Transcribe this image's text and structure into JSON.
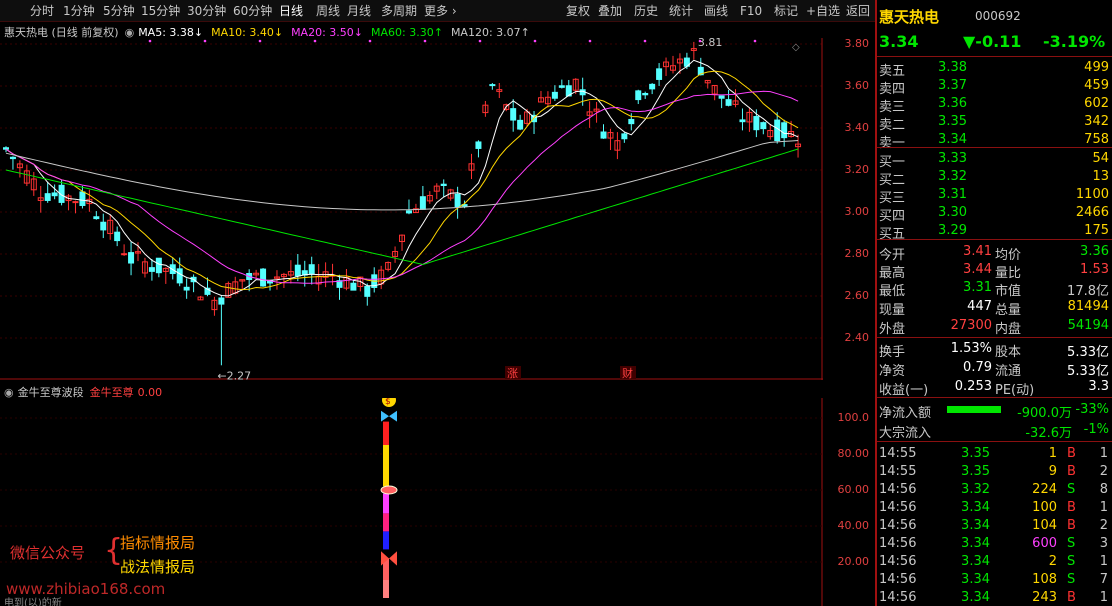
{
  "toolbar": {
    "tabs": [
      "分时",
      "1分钟",
      "5分钟",
      "15分钟",
      "30分钟",
      "60分钟",
      "日线",
      "周线",
      "月线",
      "多周期",
      "更多 ›"
    ],
    "right_items": [
      "复权",
      "叠加",
      "历史",
      "统计",
      "画线",
      "F10",
      "标记",
      "+自选",
      "返回"
    ],
    "active_tab": "日线"
  },
  "chart": {
    "title": "惠天热电 (日线 前复权)",
    "ma": [
      {
        "label": "MA5: 3.38↓",
        "color": "#ffffff"
      },
      {
        "label": "MA10: 3.40↓",
        "color": "#ffd700"
      },
      {
        "label": "MA20: 3.50↓",
        "color": "#ff40ff"
      },
      {
        "label": "MA60: 3.30↑",
        "color": "#00e600"
      },
      {
        "label": "MA120: 3.07↑",
        "color": "#c8c8c8"
      }
    ],
    "high_label": "3.81",
    "low_label": "←2.27",
    "badges": [
      "涨",
      "财"
    ],
    "y_ticks": [
      "3.80",
      "3.60",
      "3.40",
      "3.20",
      "3.00",
      "2.80",
      "2.60",
      "2.40"
    ]
  },
  "indicator": {
    "title": "金牛至尊波段",
    "name": "金牛至尊",
    "value": "0.00",
    "y_ticks": [
      "100.0",
      "80.00",
      "60.00",
      "40.00",
      "20.00"
    ]
  },
  "watermark": {
    "wechat": "微信公众号",
    "brand1": "指标情报局",
    "brand2": "战法情报局",
    "site": "www.zhibiao168.com",
    "small": "电到(以)的新"
  },
  "quote": {
    "name": "惠天热电",
    "code": "000692",
    "price": "3.34",
    "change": "▼-0.11",
    "pct": "-3.19%",
    "asks": [
      {
        "label": "卖五",
        "price": "3.38",
        "vol": "499"
      },
      {
        "label": "卖四",
        "price": "3.37",
        "vol": "459"
      },
      {
        "label": "卖三",
        "price": "3.36",
        "vol": "602"
      },
      {
        "label": "卖二",
        "price": "3.35",
        "vol": "342"
      },
      {
        "label": "卖一",
        "price": "3.34",
        "vol": "758"
      }
    ],
    "bids": [
      {
        "label": "买一",
        "price": "3.33",
        "vol": "54"
      },
      {
        "label": "买二",
        "price": "3.32",
        "vol": "13"
      },
      {
        "label": "买三",
        "price": "3.31",
        "vol": "1100"
      },
      {
        "label": "买四",
        "price": "3.30",
        "vol": "2466"
      },
      {
        "label": "买五",
        "price": "3.29",
        "vol": "175"
      }
    ],
    "stats": [
      {
        "l1": "今开",
        "v1": "3.41",
        "l2": "均价",
        "v2": "3.36"
      },
      {
        "l1": "最高",
        "v1": "3.44",
        "l2": "量比",
        "v2": "1.53"
      },
      {
        "l1": "最低",
        "v1": "3.31",
        "l2": "市值",
        "v2": "17.8亿"
      },
      {
        "l1": "现量",
        "v1": "447",
        "l2": "总量",
        "v2": "81494"
      },
      {
        "l1": "外盘",
        "v1": "27300",
        "l2": "内盘",
        "v2": "54194"
      }
    ],
    "fin": [
      {
        "l1": "换手",
        "v1": "1.53%",
        "l2": "股本",
        "v2": "5.33亿"
      },
      {
        "l1": "净资",
        "v1": "0.79",
        "l2": "流通",
        "v2": "5.33亿"
      },
      {
        "l1": "收益(一)",
        "v1": "0.253",
        "l2": "PE(动)",
        "v2": "3.3"
      }
    ],
    "flow": [
      {
        "label": "净流入额",
        "value": "-900.0万",
        "pct": "-33%"
      },
      {
        "label": "大宗流入",
        "value": "-32.6万",
        "pct": "-1%"
      }
    ],
    "ticks": [
      {
        "t": "14:55",
        "p": "3.35",
        "v": "1",
        "s": "B"
      },
      {
        "t": "14:55",
        "p": "3.35",
        "v": "9",
        "s": "B"
      },
      {
        "t": "14:56",
        "p": "3.32",
        "v": "224",
        "s": "S"
      },
      {
        "t": "14:56",
        "p": "3.34",
        "v": "100",
        "s": "B"
      },
      {
        "t": "14:56",
        "p": "3.34",
        "v": "104",
        "s": "B"
      },
      {
        "t": "14:56",
        "p": "3.34",
        "v": "600",
        "s": "S"
      },
      {
        "t": "14:56",
        "p": "3.34",
        "v": "2",
        "s": "S"
      },
      {
        "t": "14:56",
        "p": "3.34",
        "v": "108",
        "s": "S"
      },
      {
        "t": "14:56",
        "p": "3.34",
        "v": "243",
        "s": "B"
      }
    ],
    "tick_extra": [
      "1",
      "2",
      "8",
      "1",
      "2",
      "3",
      "1",
      "7",
      "1"
    ]
  }
}
